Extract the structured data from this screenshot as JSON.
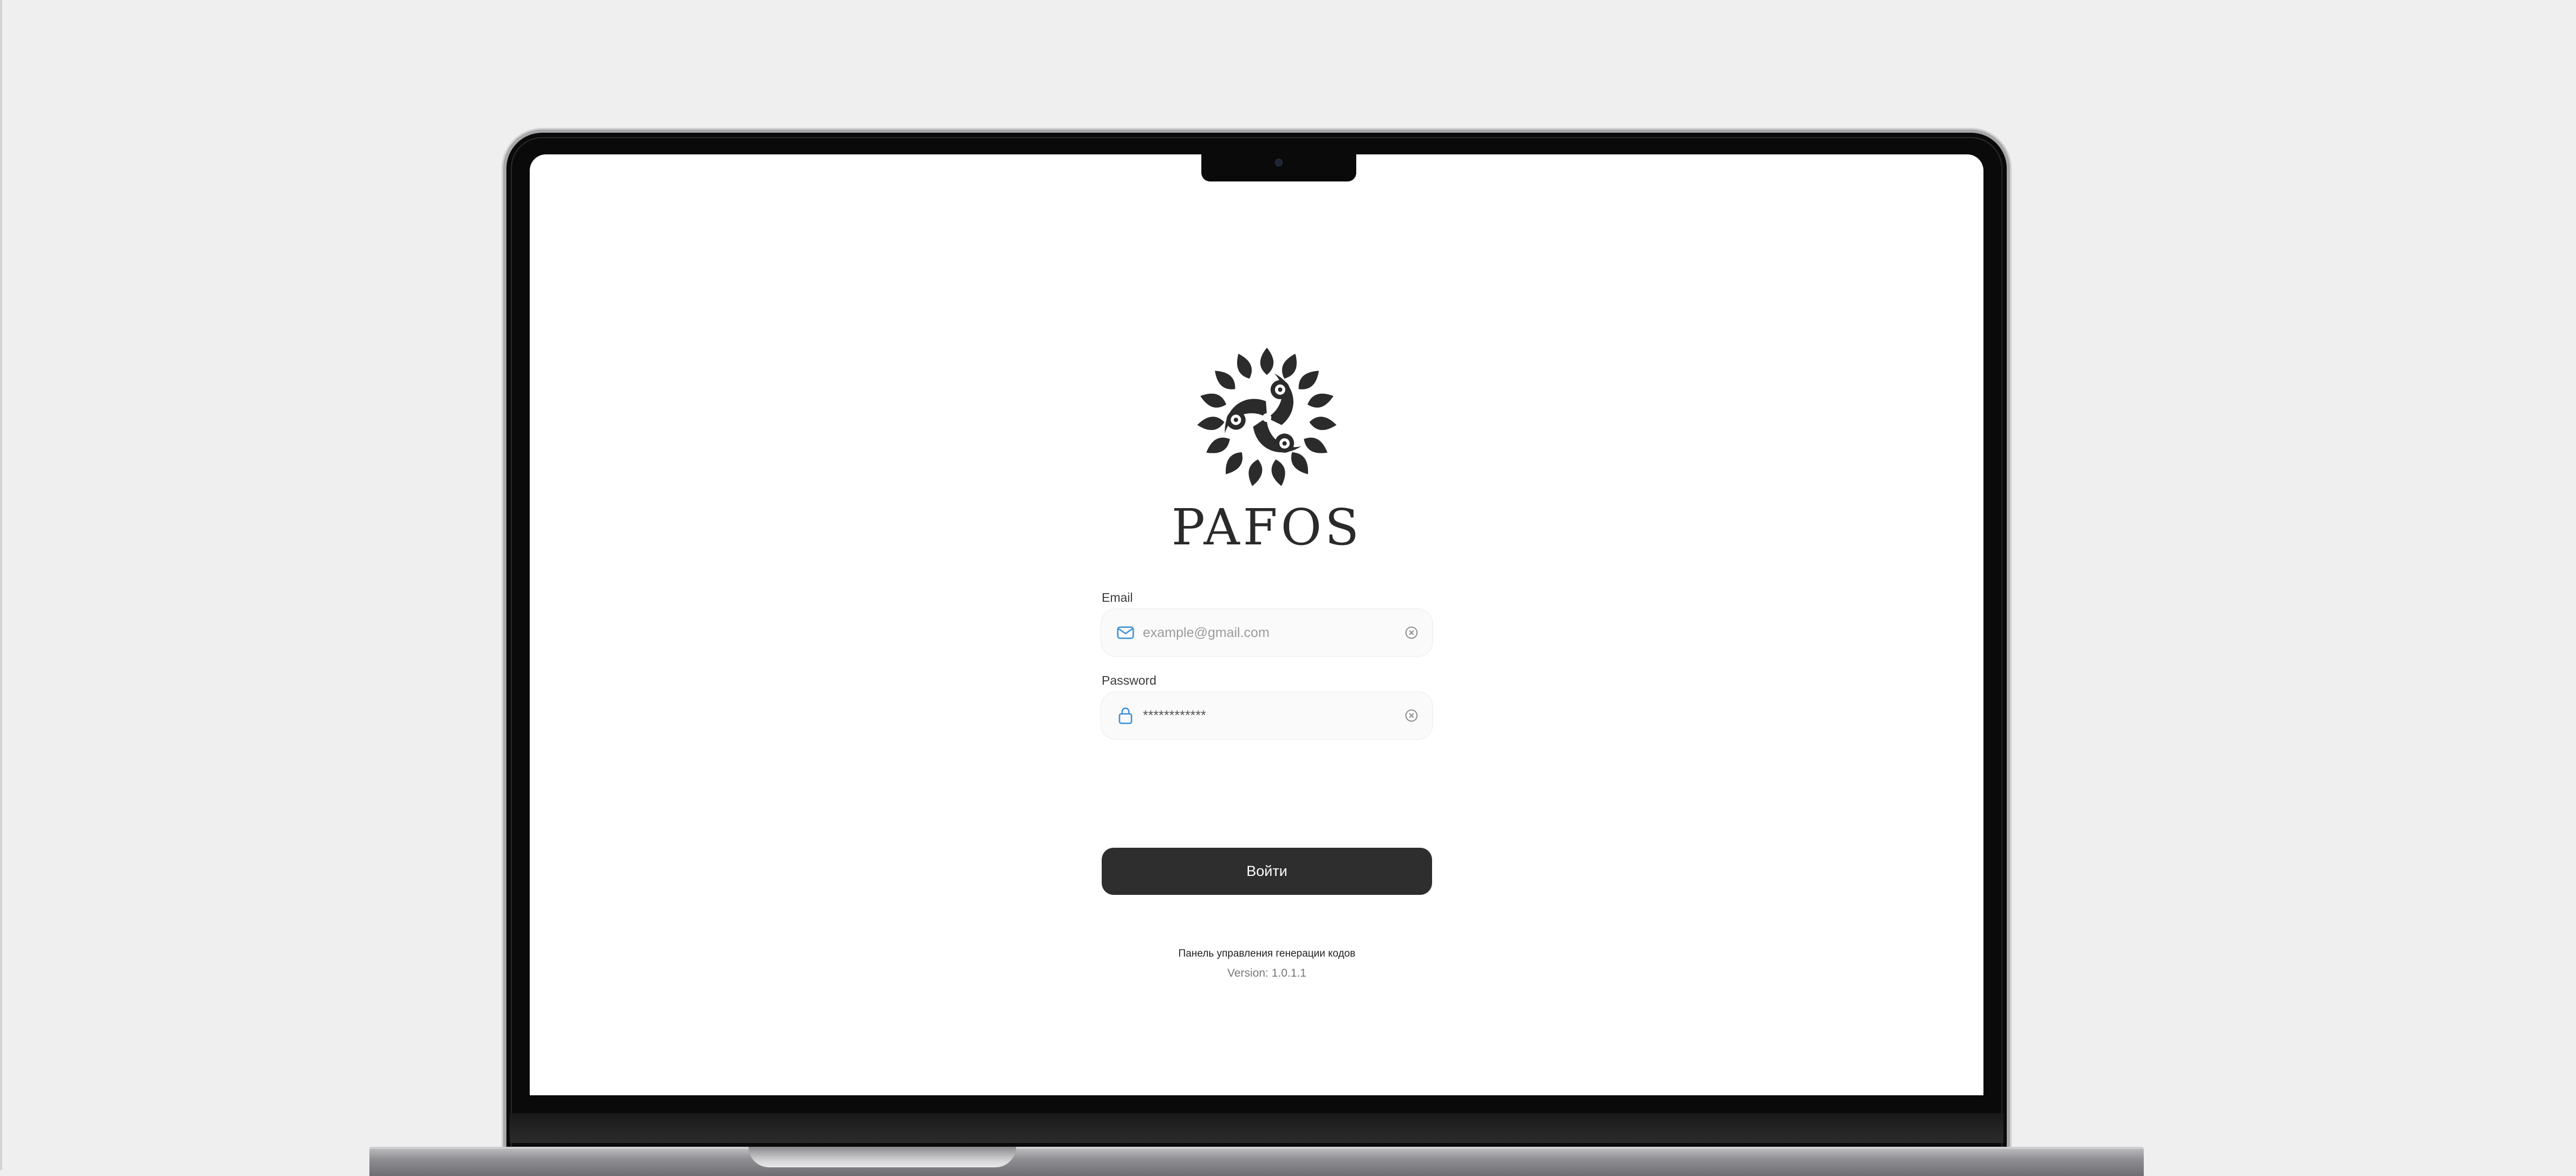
{
  "brand": {
    "name": "PAFOS",
    "logo_icon": "ornamental-floral-emblem"
  },
  "login": {
    "email_label": "Email",
    "email_placeholder": "example@gmail.com",
    "email_value": "",
    "email_icon": "envelope-icon",
    "password_label": "Password",
    "password_value": "************",
    "password_icon": "lock-icon",
    "clear_icon": "clear-circle-x-icon",
    "submit_label": "Войти"
  },
  "footer": {
    "title": "Панель управления генерации кодов",
    "version": "Version: 1.0.1.1"
  },
  "colors": {
    "page_background": "#efefef",
    "screen_background": "#ffffff",
    "button_background": "#2e2e2e",
    "accent_icon": "#3b8fd6",
    "brand_text": "#2a2a2a"
  }
}
